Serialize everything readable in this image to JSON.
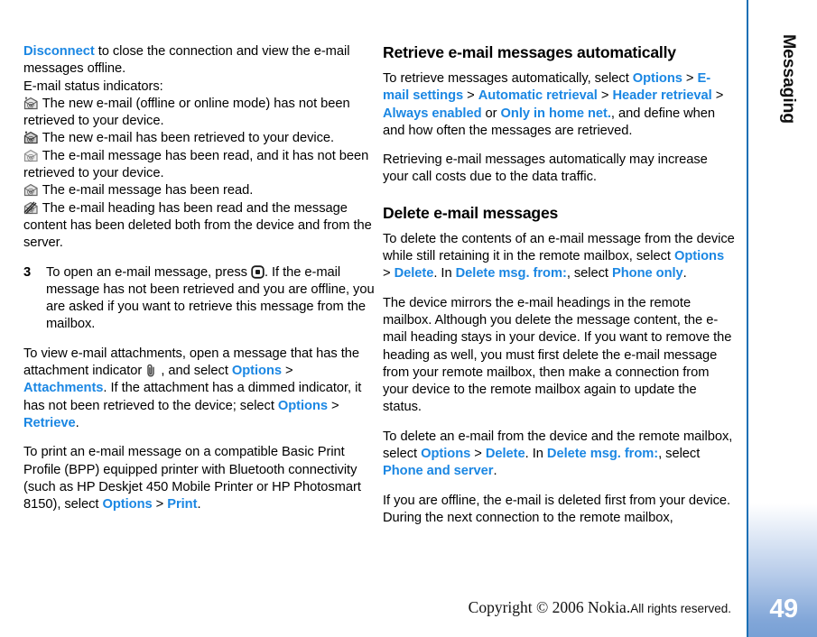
{
  "document": {
    "chapter_tab_label": "Messaging",
    "page_number": "49",
    "accent_color": "#1b87e3",
    "tab_color": "#7ca4d6",
    "rule_color": "#1a6fb5"
  },
  "footer": {
    "copyright": "Copyright © 2006 Nokia.",
    "rights": "All rights reserved."
  },
  "left_column": {
    "continuation": {
      "menu_disconnect": "Disconnect",
      "text_after": " to close the connection and view the e-mail messages offline.",
      "status_heading": "E-mail status indicators:"
    },
    "status_indicators": [
      {
        "icon": "new-email-not-retrieved-icon",
        "text": "The new e-mail (offline or online mode) has not been retrieved to your device."
      },
      {
        "icon": "new-email-retrieved-icon",
        "text": "The new e-mail has been retrieved to your device."
      },
      {
        "icon": "email-read-not-retrieved-icon",
        "text": "The e-mail message has been read, and it has not been retrieved to your device."
      },
      {
        "icon": "email-read-icon",
        "text": "The e-mail message has been read."
      },
      {
        "icon": "email-heading-deleted-icon",
        "text": "The e-mail heading has been read and the message content has been deleted both from the device and from the server."
      }
    ],
    "step": {
      "number": "3",
      "text_before_key": "To open an e-mail message, press ",
      "key_icon": "scroll-key-icon",
      "text_after_key": ". If the e-mail message has not been retrieved and you are offline, you are asked if you want to retrieve this message from the mailbox."
    },
    "attachments_paragraph": {
      "t1": "To view e-mail attachments, open a message that has the attachment indicator ",
      "icon": "paperclip-icon",
      "t2": " , and select ",
      "m1": "Options",
      "sep1": " > ",
      "m2": "Attachments",
      "t3": ". If the attachment has a dimmed indicator, it has not been retrieved to the device; select ",
      "m3": "Options",
      "sep2": " > ",
      "m4": "Retrieve",
      "t4": "."
    },
    "print_paragraph": {
      "t1": "To print an e-mail message on a compatible Basic Print Profile (BPP) equipped printer with Bluetooth connectivity (such as HP Deskjet 450 Mobile Printer or HP Photosmart 8150), select ",
      "m1": "Options",
      "sep1": " > ",
      "m2": "Print",
      "t2": "."
    }
  },
  "right_column": {
    "section_auto": {
      "heading": "Retrieve e-mail messages automatically",
      "p1": {
        "t1": "To retrieve messages automatically, select ",
        "m1": "Options",
        "sep1": " > ",
        "m2": "E-mail settings",
        "sep2": " > ",
        "m3": "Automatic retrieval",
        "sep3": " > ",
        "m4": "Header retrieval",
        "sep4": " > ",
        "m5": "Always enabled",
        "or": " or ",
        "m6": "Only in home net.",
        "t2": ", and define when and how often the messages are retrieved."
      },
      "p2": "Retrieving e-mail messages automatically may increase your call costs due to the data traffic."
    },
    "section_delete": {
      "heading": "Delete e-mail messages",
      "p1": {
        "t1": "To delete the contents of an e-mail message from the device while still retaining it in the remote mailbox, select ",
        "m1": "Options",
        "sep1": " > ",
        "m2": "Delete",
        "t2": ". In ",
        "m3": "Delete msg. from:",
        "t3": ", select ",
        "m4": "Phone only",
        "t4": "."
      },
      "p2": "The device mirrors the e-mail headings in the remote mailbox. Although you delete the message content, the e-mail heading stays in your device. If you want to remove the heading as well, you must first delete the e-mail message from your remote mailbox, then make a connection from your device to the remote mailbox again to update the status.",
      "p3": {
        "t1": "To delete an e-mail from the device and the remote mailbox, select ",
        "m1": "Options",
        "sep1": " > ",
        "m2": "Delete",
        "t2": ". In ",
        "m3": "Delete msg. from:",
        "t3": ", select ",
        "m4": "Phone and server",
        "t4": "."
      },
      "p4": "If you are offline, the e-mail is deleted first from your device. During the next connection to the remote mailbox,"
    }
  }
}
